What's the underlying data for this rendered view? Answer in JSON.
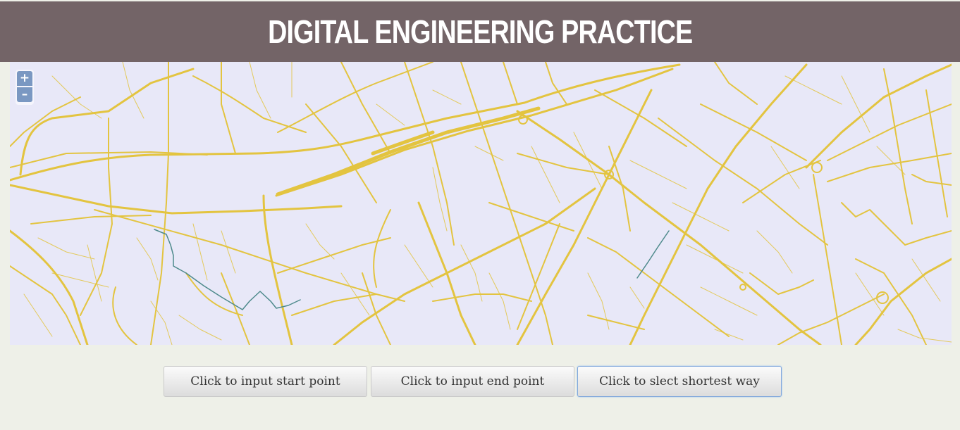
{
  "header": {
    "title": "DIGITAL ENGINEERING PRACTICE"
  },
  "map": {
    "zoom_in_label": "+",
    "zoom_out_label": "–",
    "colors": {
      "background": "#e8e8f8",
      "road": "#e3c440",
      "route": "#4e8a8c"
    }
  },
  "controls": {
    "start_label": "Click to input start point",
    "end_label": "Click to input end point",
    "shortest_label": "Click to slect shortest way"
  }
}
